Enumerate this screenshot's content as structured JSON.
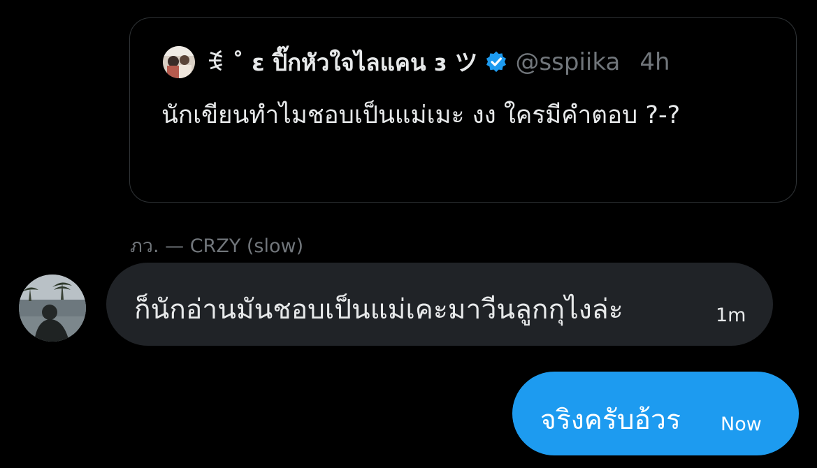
{
  "quoted_tweet": {
    "author_name": "ꉂ ˚ ɛ ปิ๊กหัวใจไลแคน ɜ ツ",
    "verified_icon": "verified-badge-icon",
    "handle": "@sspiika",
    "time": "4h",
    "text": "นักเขียนทำไมชอบเป็นแม่เมะ งง ใครมีคำตอบ ?-?"
  },
  "sender": {
    "label": "ภว. — CRZY (slow)"
  },
  "messages": [
    {
      "direction": "incoming",
      "text": "ก็นักอ่านมันชอบเป็นแม่เคะมาวีนลูกกุไงล่ะ",
      "time": "1m"
    },
    {
      "direction": "outgoing",
      "text": "จริงครับอ้วร",
      "time": "Now"
    }
  ],
  "colors": {
    "background": "#000000",
    "card_border": "#2f3336",
    "incoming_bubble": "#202327",
    "outgoing_bubble": "#1d9bf0",
    "verified": "#1d9bf0",
    "muted_text": "#71767b"
  }
}
